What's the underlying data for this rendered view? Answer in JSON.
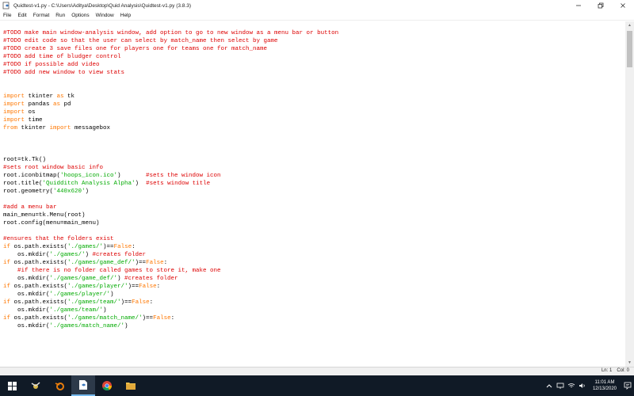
{
  "window": {
    "title": "Quidtest-v1.py - C:\\Users\\Aditya\\Desktop\\Quid Analysis\\Quidtest-v1.py (3.8.3)"
  },
  "menu": [
    "File",
    "Edit",
    "Format",
    "Run",
    "Options",
    "Window",
    "Help"
  ],
  "code": [
    [
      [
        "c",
        "#TODO make main window-analysis window, add option to go to new window as a menu bar or button"
      ]
    ],
    [
      [
        "c",
        "#TODO edit code so that the user can select by match_name then select by game"
      ]
    ],
    [
      [
        "c",
        "#TODO create 3 save files one for players one for teams one for match_name"
      ]
    ],
    [
      [
        "c",
        "#TODO add time of bludger control"
      ]
    ],
    [
      [
        "c",
        "#TODO if possible add video"
      ]
    ],
    [
      [
        "c",
        "#TODO add new window to view stats"
      ]
    ],
    [],
    [],
    [
      [
        "k",
        "import"
      ],
      [
        "n",
        " tkinter "
      ],
      [
        "k",
        "as"
      ],
      [
        "n",
        " tk"
      ]
    ],
    [
      [
        "k",
        "import"
      ],
      [
        "n",
        " pandas "
      ],
      [
        "k",
        "as"
      ],
      [
        "n",
        " pd"
      ]
    ],
    [
      [
        "k",
        "import"
      ],
      [
        "n",
        " os"
      ]
    ],
    [
      [
        "k",
        "import"
      ],
      [
        "n",
        " time"
      ]
    ],
    [
      [
        "k",
        "from"
      ],
      [
        "n",
        " tkinter "
      ],
      [
        "k",
        "import"
      ],
      [
        "n",
        " messagebox"
      ]
    ],
    [],
    [],
    [],
    [
      [
        "n",
        "root=tk.Tk()"
      ]
    ],
    [
      [
        "c",
        "#sets root window basic info"
      ]
    ],
    [
      [
        "n",
        "root.iconbitmap("
      ],
      [
        "s",
        "'hoops_icon.ico'"
      ],
      [
        "n",
        ")       "
      ],
      [
        "c",
        "#sets the window icon"
      ]
    ],
    [
      [
        "n",
        "root.title("
      ],
      [
        "s",
        "'Quidditch Analysis Alpha'"
      ],
      [
        "n",
        ")  "
      ],
      [
        "c",
        "#sets window title"
      ]
    ],
    [
      [
        "n",
        "root.geometry("
      ],
      [
        "s",
        "'440x620'"
      ],
      [
        "n",
        ")"
      ]
    ],
    [],
    [
      [
        "c",
        "#add a menu bar"
      ]
    ],
    [
      [
        "n",
        "main_menu=tk.Menu(root)"
      ]
    ],
    [
      [
        "n",
        "root.config(menu=main_menu)"
      ]
    ],
    [],
    [
      [
        "c",
        "#ensures that the folders exist"
      ]
    ],
    [
      [
        "k",
        "if"
      ],
      [
        "n",
        " os.path.exists("
      ],
      [
        "s",
        "'./games/'"
      ],
      [
        "n",
        ")=="
      ],
      [
        "k",
        "False"
      ],
      [
        "n",
        ":"
      ]
    ],
    [
      [
        "n",
        "    os.mkdir("
      ],
      [
        "s",
        "'./games/'"
      ],
      [
        "n",
        ") "
      ],
      [
        "c",
        "#creates folder"
      ]
    ],
    [
      [
        "k",
        "if"
      ],
      [
        "n",
        " os.path.exists("
      ],
      [
        "s",
        "'./games/game_def/'"
      ],
      [
        "n",
        ")=="
      ],
      [
        "k",
        "False"
      ],
      [
        "n",
        ":"
      ]
    ],
    [
      [
        "c",
        "    #if there is no folder called games to store it, make one"
      ]
    ],
    [
      [
        "n",
        "    os.mkdir("
      ],
      [
        "s",
        "'./games/game_def/'"
      ],
      [
        "n",
        ") "
      ],
      [
        "c",
        "#creates folder"
      ]
    ],
    [
      [
        "k",
        "if"
      ],
      [
        "n",
        " os.path.exists("
      ],
      [
        "s",
        "'./games/player/'"
      ],
      [
        "n",
        ")=="
      ],
      [
        "k",
        "False"
      ],
      [
        "n",
        ":"
      ]
    ],
    [
      [
        "n",
        "    os.mkdir("
      ],
      [
        "s",
        "'./games/player/'"
      ],
      [
        "n",
        ")"
      ]
    ],
    [
      [
        "k",
        "if"
      ],
      [
        "n",
        " os.path.exists("
      ],
      [
        "s",
        "'./games/team/'"
      ],
      [
        "n",
        ")=="
      ],
      [
        "k",
        "False"
      ],
      [
        "n",
        ":"
      ]
    ],
    [
      [
        "n",
        "    os.mkdir("
      ],
      [
        "s",
        "'./games/team/'"
      ],
      [
        "n",
        ")"
      ]
    ],
    [
      [
        "k",
        "if"
      ],
      [
        "n",
        " os.path.exists("
      ],
      [
        "s",
        "'./games/match_name/'"
      ],
      [
        "n",
        ")=="
      ],
      [
        "k",
        "False"
      ],
      [
        "n",
        ":"
      ]
    ],
    [
      [
        "n",
        "    os.mkdir("
      ],
      [
        "s",
        "'./games/match_name/'"
      ],
      [
        "n",
        ")"
      ]
    ]
  ],
  "status": {
    "line": "Ln: 1",
    "col": "Col: 0"
  },
  "clock": {
    "time": "11:01 AM",
    "date": "12/13/2020"
  },
  "colors": {
    "comment": "#dd0000",
    "keyword": "#ff7700",
    "string": "#00aa00",
    "taskbar": "#101a26"
  }
}
